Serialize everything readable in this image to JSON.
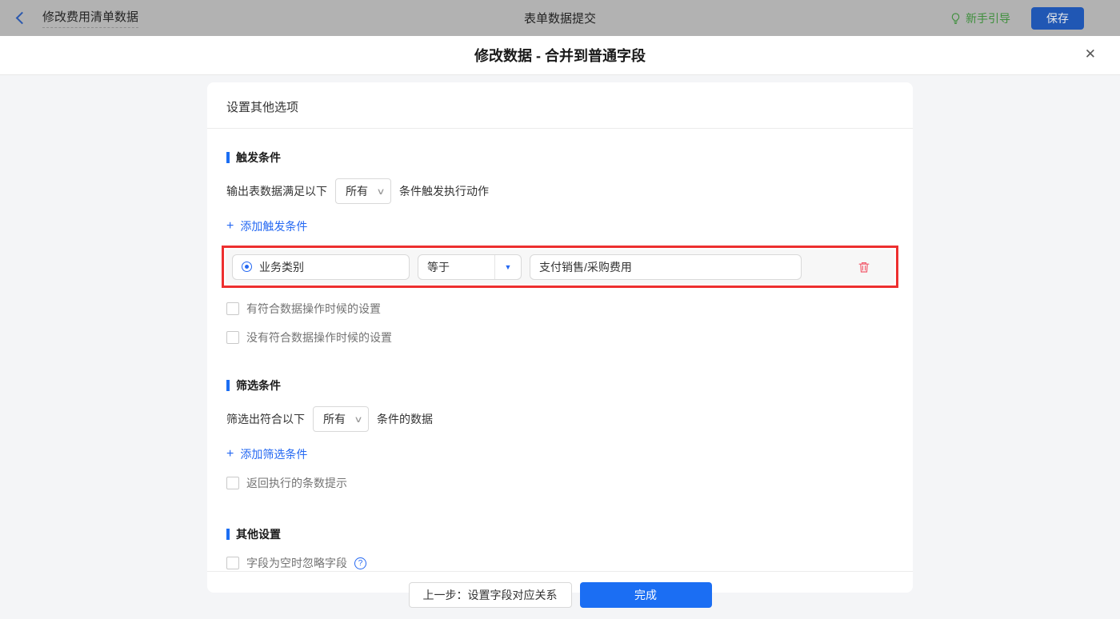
{
  "topbar": {
    "back_title": "修改费用清单数据",
    "page_title": "表单数据提交",
    "guide_label": "新手引导",
    "save_label": "保存"
  },
  "dialog": {
    "title": "修改数据 - 合并到普通字段"
  },
  "panel": {
    "header_title": "设置其他选项",
    "trigger_section": {
      "title": "触发条件",
      "sentence_prefix": "输出表数据满足以下",
      "match_select_value": "所有",
      "sentence_suffix": "条件触发执行动作",
      "add_condition_label": "添加触发条件",
      "condition": {
        "field": "业务类别",
        "operator": "等于",
        "value": "支付销售/采购费用"
      },
      "checkbox_matched_label": "有符合数据操作时候的设置",
      "checkbox_unmatched_label": "没有符合数据操作时候的设置"
    },
    "filter_section": {
      "title": "筛选条件",
      "sentence_prefix": "筛选出符合以下",
      "match_select_value": "所有",
      "sentence_suffix": "条件的数据",
      "add_filter_label": "添加筛选条件",
      "checkbox_count_label": "返回执行的条数提示"
    },
    "other_section": {
      "title": "其他设置",
      "checkbox_ignore_empty_label": "字段为空时忽略字段"
    },
    "footer": {
      "prev_button_label": "上一步：设置字段对应关系",
      "done_button_label": "完成"
    }
  },
  "icons": {
    "close": "✕",
    "plus": "+",
    "caret_down": "▼",
    "chevron_down": "∨",
    "help": "?"
  },
  "colors": {
    "accent_blue": "#1b6ef3",
    "link_blue": "#2468f2",
    "guide_green": "#3f8f3d",
    "danger_red": "#f25c6e",
    "annotation_red": "#ed2f2f"
  }
}
